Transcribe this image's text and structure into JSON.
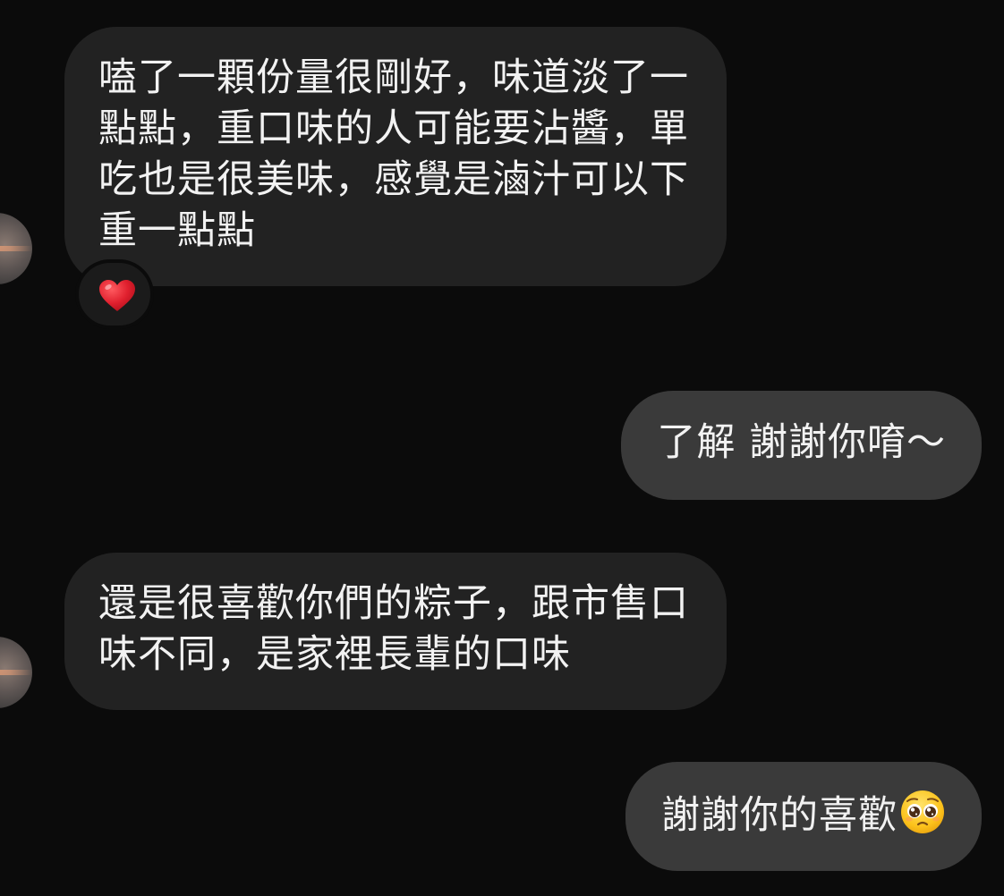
{
  "messages": [
    {
      "direction": "incoming",
      "text": "嗑了一顆份量很剛好，味道淡了一點點，重口味的人可能要沾醬，單吃也是很美味，感覺是滷汁可以下重一點點",
      "reaction": "red-heart"
    },
    {
      "direction": "outgoing",
      "text": "了解 謝謝你唷～"
    },
    {
      "direction": "incoming",
      "text": "還是很喜歡你們的粽子，跟市售口味不同，是家裡長輩的口味"
    },
    {
      "direction": "outgoing",
      "text": "謝謝你的喜歡",
      "emoji": "pleading-face"
    }
  ],
  "colors": {
    "background": "#0b0b0b",
    "incoming_bubble": "#222222",
    "outgoing_bubble": "#3a3a3a",
    "text": "#f2f2f2",
    "heart": "#e0202e"
  }
}
